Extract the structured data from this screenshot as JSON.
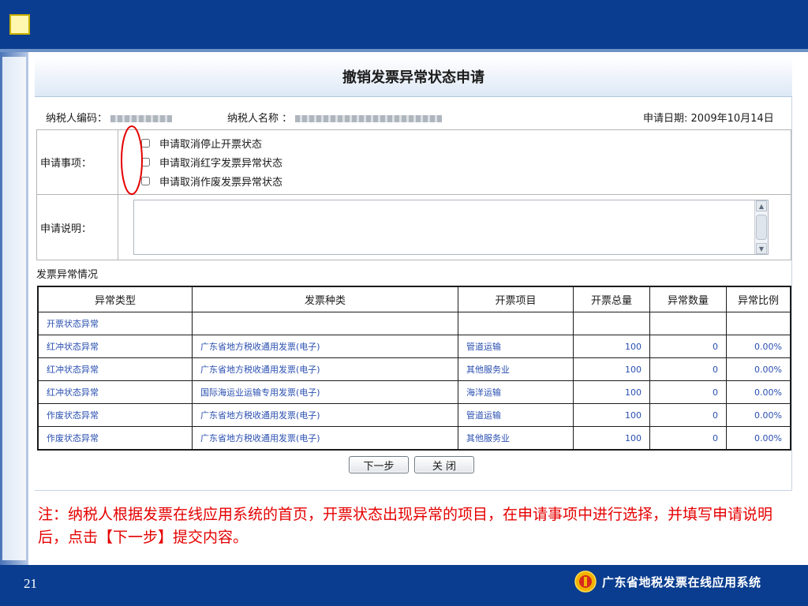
{
  "slide": {
    "page_number": "21",
    "brand_name": "广东省地税发票在线应用系统"
  },
  "form": {
    "title": "撤销发票异常状态申请",
    "taxpayer_id_label": "纳税人编码：",
    "taxpayer_name_label": "纳税人名称  ：",
    "apply_date_label": "申请日期:",
    "apply_date_value": "2009年10月14日",
    "items_label": "申请事项：",
    "items": [
      {
        "label": "申请取消停止开票状态",
        "checked": false
      },
      {
        "label": "申请取消红字发票异常状态",
        "checked": false
      },
      {
        "label": "申请取消作废发票异常状态",
        "checked": false
      }
    ],
    "description_label": "申请说明：",
    "description_value": ""
  },
  "table": {
    "section_title": "发票异常情况",
    "headers": [
      "异常类型",
      "发票种类",
      "开票项目",
      "开票总量",
      "异常数量",
      "异常比例"
    ],
    "rows": [
      [
        "开票状态异常",
        "",
        "",
        "",
        "",
        ""
      ],
      [
        "红冲状态异常",
        "广东省地方税收通用发票(电子)",
        "管道运输",
        "100",
        "0",
        "0.00%"
      ],
      [
        "红冲状态异常",
        "广东省地方税收通用发票(电子)",
        "其他服务业",
        "100",
        "0",
        "0.00%"
      ],
      [
        "红冲状态异常",
        "国际海运业运输专用发票(电子)",
        "海洋运输",
        "100",
        "0",
        "0.00%"
      ],
      [
        "作废状态异常",
        "广东省地方税收通用发票(电子)",
        "管道运输",
        "100",
        "0",
        "0.00%"
      ],
      [
        "作废状态异常",
        "广东省地方税收通用发票(电子)",
        "其他服务业",
        "100",
        "0",
        "0.00%"
      ]
    ]
  },
  "buttons": {
    "next": "下一步",
    "close": "关 闭"
  },
  "note": "注：纳税人根据发票在线应用系统的首页，开票状态出现异常的项目，在申请事项中进行选择，并填写申请说明后，点击【下一步】提交内容。",
  "colors": {
    "top_bar": "#0a3d8f",
    "link_blue": "#2a4fb0",
    "note_red": "#e50000"
  }
}
